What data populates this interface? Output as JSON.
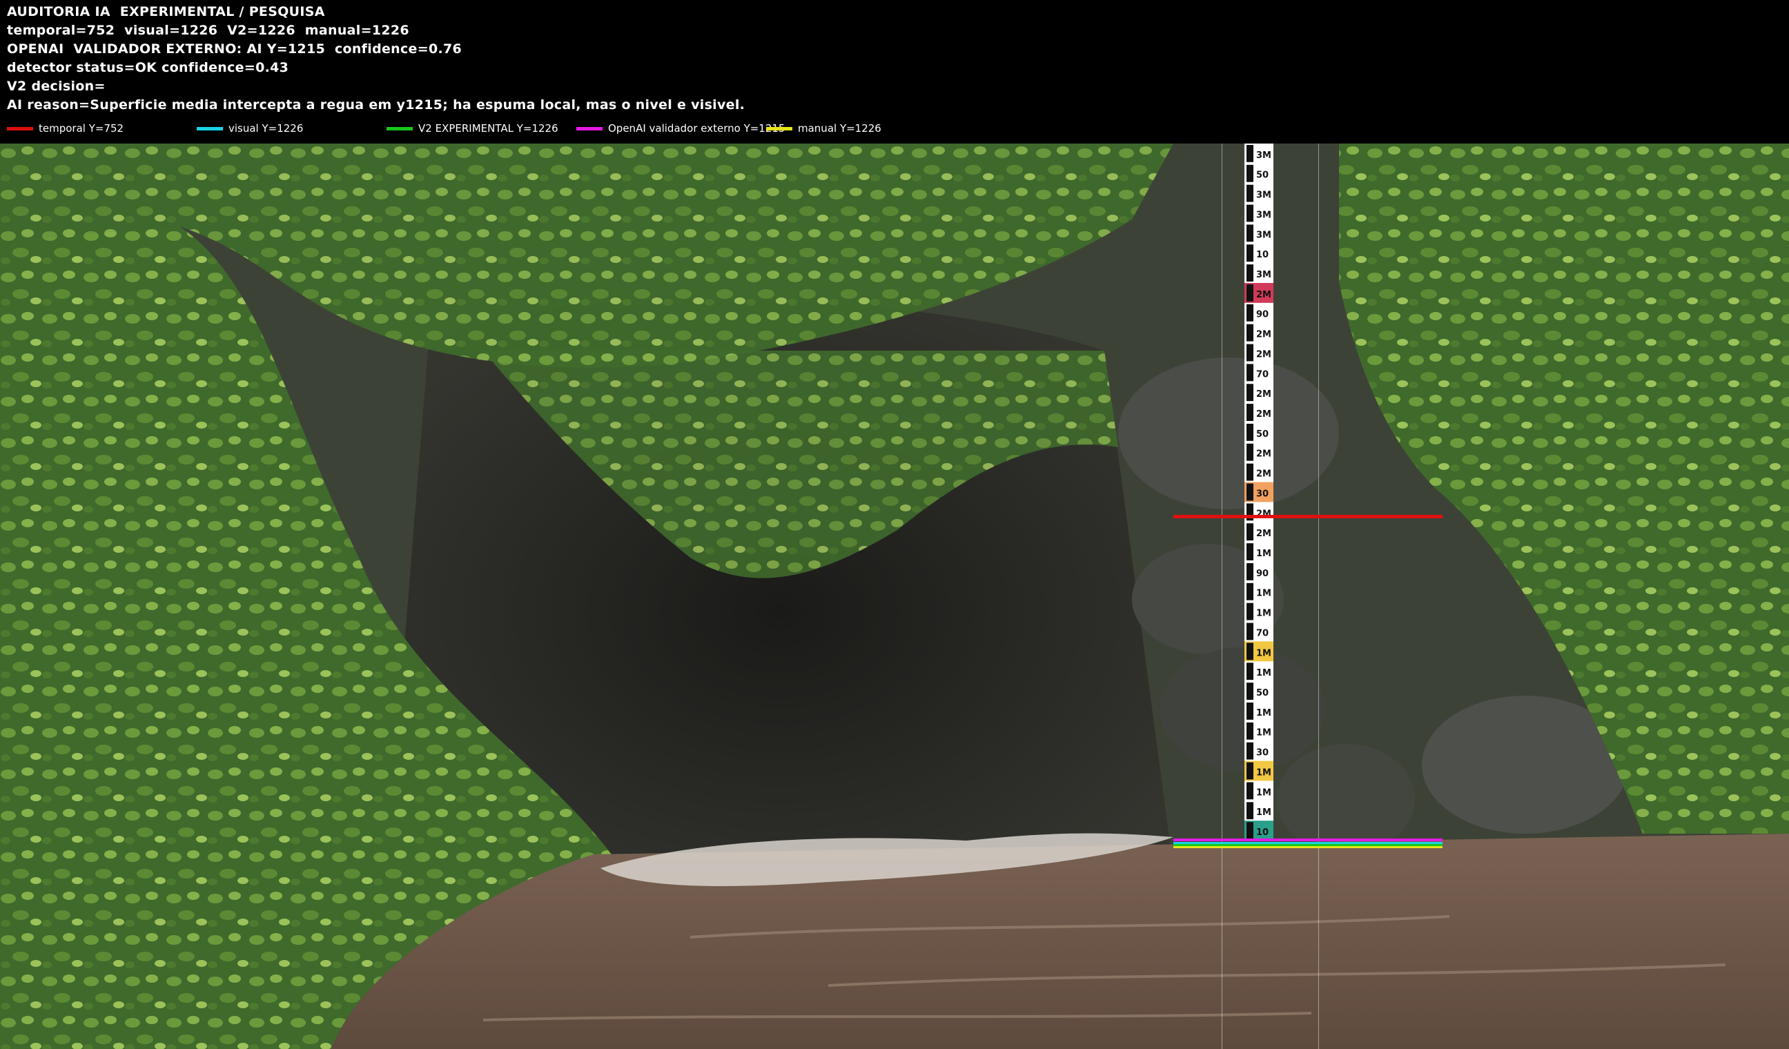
{
  "hud": {
    "title": "AUDITORIA IA  EXPERIMENTAL / PESQUISA",
    "levels": "temporal=752  visual=1226  V2=1226  manual=1226",
    "openai": "OPENAI  VALIDADOR EXTERNO: AI Y=1215  confidence=0.76",
    "detector": "detector status=OK confidence=0.43",
    "decision": "V2 decision=",
    "reason": "AI reason=Superficie media intercepta a regua em y1215; ha espuma local, mas o nivel e visivel."
  },
  "legend": [
    {
      "label": "temporal Y=752",
      "color": "#e11010"
    },
    {
      "label": "visual Y=1226",
      "color": "#19d3e6"
    },
    {
      "label": "V2 EXPERIMENTAL Y=1226",
      "color": "#19c619"
    },
    {
      "label": "OpenAI validador externo Y=1215",
      "color": "#e619e6"
    },
    {
      "label": "manual Y=1226",
      "color": "#e6e619"
    }
  ],
  "overlay_colors": {
    "temporal": "#e11010",
    "openai": "#e619e6",
    "visual": "#19d3e6",
    "v2": "#19c619",
    "manual": "#e6e619"
  },
  "gauge": {
    "labels": [
      "3M",
      "50",
      "3M",
      "3M",
      "3M",
      "10",
      "3M",
      "2M",
      "90",
      "2M",
      "2M",
      "70",
      "2M",
      "2M",
      "50",
      "2M",
      "2M",
      "30",
      "2M",
      "2M",
      "1M",
      "90",
      "1M",
      "1M",
      "70",
      "1M",
      "1M",
      "50",
      "1M",
      "1M",
      "30",
      "1M",
      "1M",
      "1M",
      "10"
    ],
    "colors": {
      "red": "#d23a5a",
      "orange": "#f2a060",
      "yellow": "#f2c842",
      "teal": "#2aa08a"
    }
  }
}
